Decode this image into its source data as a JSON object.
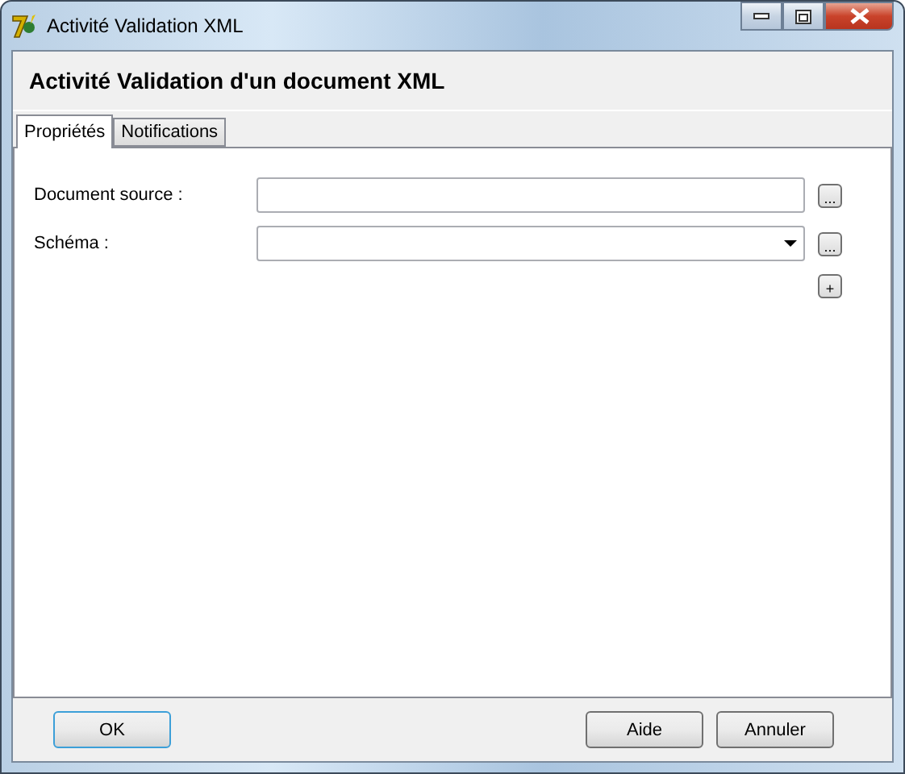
{
  "window": {
    "title": "Activité Validation XML"
  },
  "header": {
    "title": "Activité Validation d'un document XML"
  },
  "tabs": [
    {
      "label": "Propriétés",
      "selected": true
    },
    {
      "label": "Notifications",
      "selected": false
    }
  ],
  "fields": [
    {
      "kind": "text",
      "label": "Document source :",
      "browse": "..."
    },
    {
      "kind": "dropdown",
      "label": "Schéma :",
      "browse": "..."
    }
  ],
  "add_button": "+",
  "buttons": {
    "ok": "OK",
    "help": "Aide",
    "cancel": "Annuler"
  }
}
